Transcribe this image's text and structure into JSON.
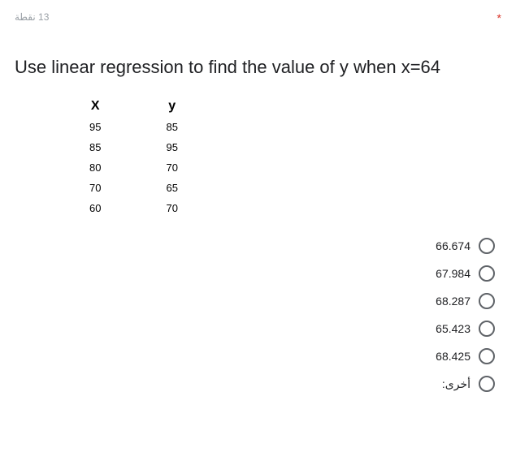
{
  "header": {
    "points_label": "13 نقطة",
    "required_mark": "*"
  },
  "question": {
    "text": "Use linear regression to find the value of y when x=64"
  },
  "table": {
    "headers": {
      "x": "X",
      "y": "y"
    },
    "rows": [
      {
        "x": "95",
        "y": "85"
      },
      {
        "x": "85",
        "y": "95"
      },
      {
        "x": "80",
        "y": "70"
      },
      {
        "x": "70",
        "y": "65"
      },
      {
        "x": "60",
        "y": "70"
      }
    ]
  },
  "options": [
    {
      "label": "66.674"
    },
    {
      "label": "67.984"
    },
    {
      "label": "68.287"
    },
    {
      "label": "65.423"
    },
    {
      "label": "68.425"
    },
    {
      "label": "أخرى:"
    }
  ]
}
